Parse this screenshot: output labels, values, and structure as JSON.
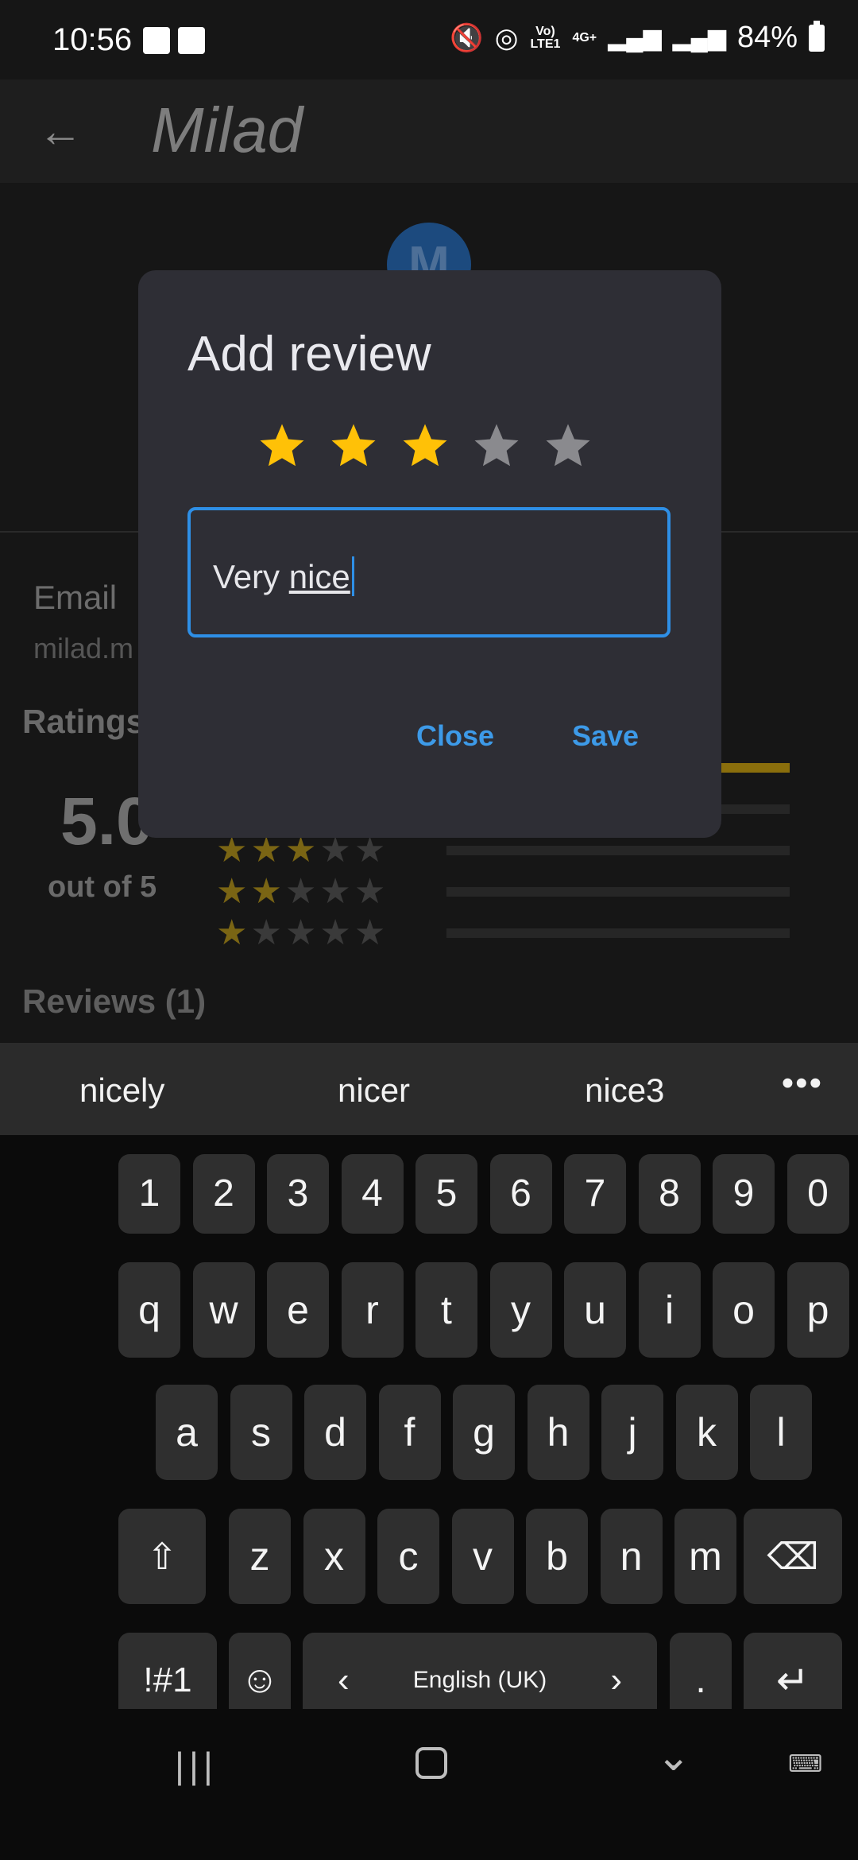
{
  "status_bar": {
    "time": "10:56",
    "battery": "84%",
    "network": "4G+",
    "volte": "Vo) LTE1"
  },
  "toolbar": {
    "title": "Milad",
    "back_icon": "back-arrow-icon"
  },
  "profile": {
    "avatar_letter": "M",
    "email_label": "Email",
    "email_value": "milad.m",
    "ratings_title": "Ratings",
    "score": "5.0",
    "out_of": "out of 5",
    "rating_rows": [
      {
        "stars": 5,
        "fill": 1.0
      },
      {
        "stars": 4,
        "fill": 0.0
      },
      {
        "stars": 3,
        "fill": 0.0
      },
      {
        "stars": 2,
        "fill": 0.0
      },
      {
        "stars": 1,
        "fill": 0.0
      }
    ],
    "reviews_title": "Reviews (1)"
  },
  "dialog": {
    "title": "Add review",
    "rating": 3,
    "max_rating": 5,
    "input_text_prefix": "Very ",
    "input_text_word": "nice",
    "close_label": "Close",
    "save_label": "Save",
    "star_color_on": "#ffc107",
    "star_color_off": "#8a8a8e",
    "accent": "#2e8fe6"
  },
  "keyboard": {
    "suggestions": [
      "nicely",
      "nicer",
      "nice3"
    ],
    "more_label": "•••",
    "number_row": [
      "1",
      "2",
      "3",
      "4",
      "5",
      "6",
      "7",
      "8",
      "9",
      "0"
    ],
    "row1": [
      "q",
      "w",
      "e",
      "r",
      "t",
      "y",
      "u",
      "i",
      "o",
      "p"
    ],
    "row2": [
      "a",
      "s",
      "d",
      "f",
      "g",
      "h",
      "j",
      "k",
      "l"
    ],
    "row3": [
      "z",
      "x",
      "c",
      "v",
      "b",
      "n",
      "m"
    ],
    "symbols_label": "!#1",
    "space_label": "English (UK)",
    "period_label": ".",
    "shift_icon": "shift-icon",
    "backspace_icon": "backspace-icon",
    "enter_icon": "enter-icon",
    "emoji_icon": "emoji-icon"
  },
  "nav_bar": {
    "recents_icon": "recents-icon",
    "home_icon": "home-icon",
    "back_icon": "nav-back-icon",
    "keyboard_icon": "keyboard-hide-icon"
  }
}
